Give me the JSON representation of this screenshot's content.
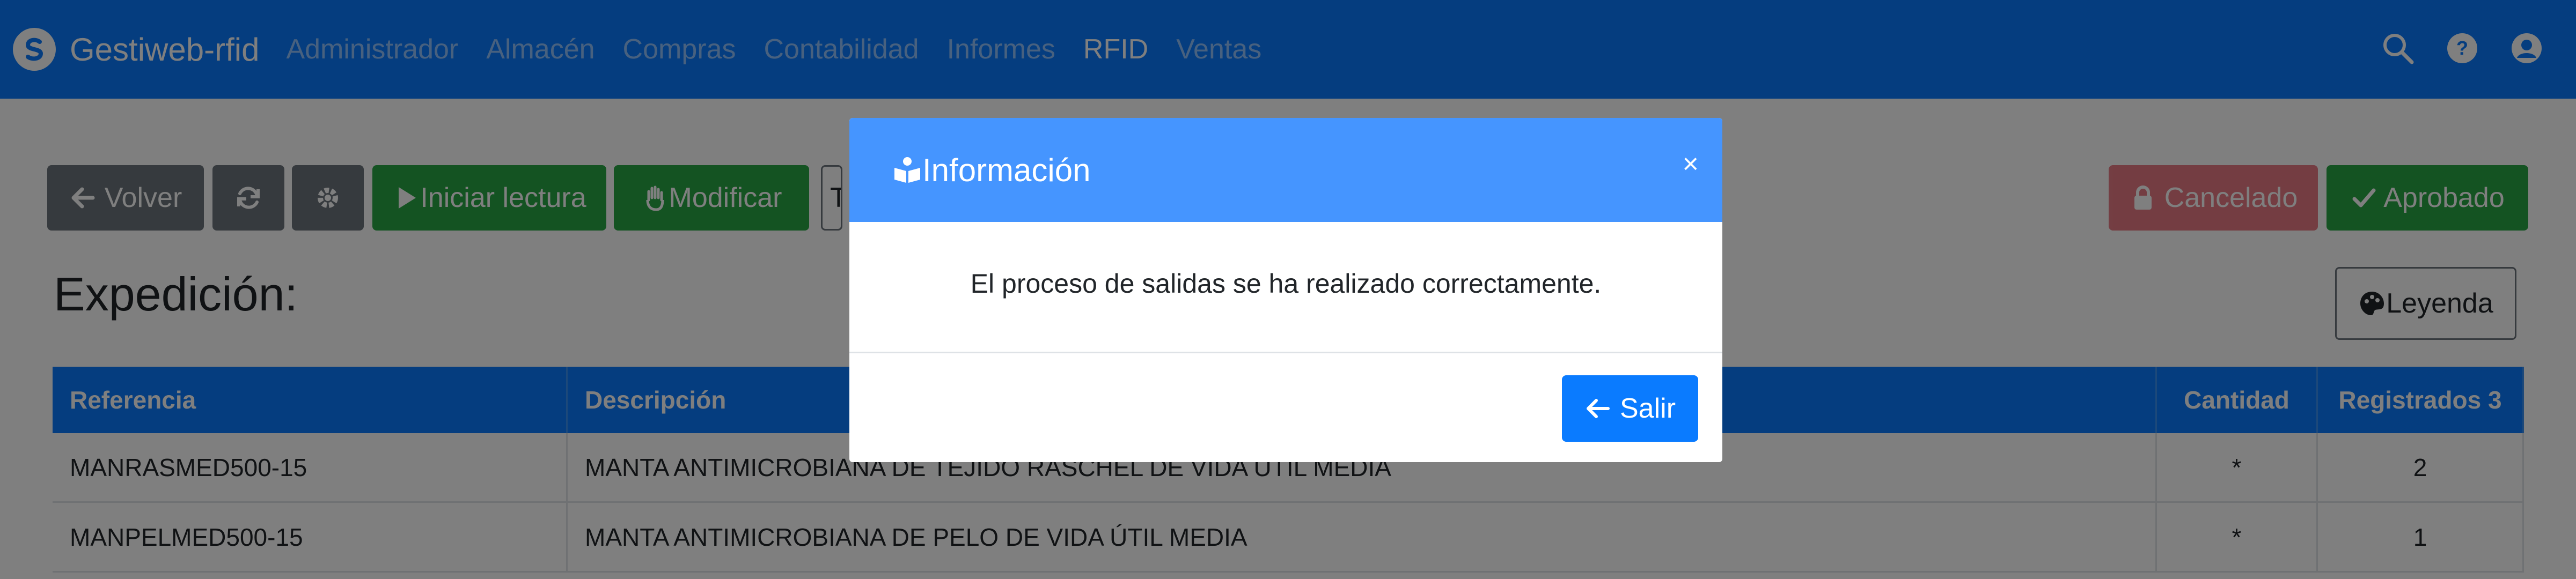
{
  "navbar": {
    "brand": "Gestiweb-rfid",
    "menu": [
      "Administrador",
      "Almacén",
      "Compras",
      "Contabilidad",
      "Informes",
      "RFID",
      "Ventas"
    ],
    "active": "RFID",
    "icons": [
      "search-icon",
      "help-icon",
      "user-icon"
    ]
  },
  "toolbar": {
    "back_label": "Volver",
    "start_reading_label": "Iniciar lectura",
    "modify_label": "Modificar",
    "select_value": "TI",
    "cancelled_label": "Cancelado",
    "approved_label": "Aprobado",
    "legend_label": "Leyenda"
  },
  "page": {
    "title": "Expedición:"
  },
  "table": {
    "headers": [
      "Referencia",
      "Descripción",
      "Cantidad",
      "Registrados 3"
    ],
    "rows": [
      [
        "MANRASMED500-15",
        "MANTA ANTIMICROBIANA DE TEJIDO RASCHEL DE VIDA ÚTIL MEDIA",
        "*",
        "2"
      ],
      [
        "MANPELMED500-15",
        "MANTA ANTIMICROBIANA DE PELO DE VIDA ÚTIL MEDIA",
        "*",
        "1"
      ]
    ]
  },
  "modal": {
    "title": "Información",
    "close": "×",
    "message": "El proceso de salidas se ha realizado correctamente.",
    "exit_label": "Salir"
  },
  "colors": {
    "primary": "#0a7bff",
    "success": "#28a745",
    "danger": "#dc3545",
    "secondary": "#6c757d"
  }
}
